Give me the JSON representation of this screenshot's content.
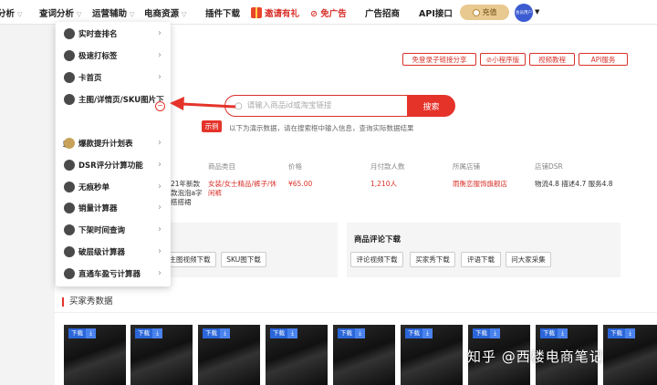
{
  "nav": {
    "items": [
      "分析",
      "查词分析",
      "运营辅助",
      "电商资源",
      "插件下载",
      "邀请有礼",
      "免广告",
      "广告招商",
      "API接口"
    ],
    "recharge": "充值",
    "avatar_text": "会员用户"
  },
  "menu": {
    "items": [
      {
        "label": "实时查排名",
        "icon": "medal-icon"
      },
      {
        "label": "极速打标签",
        "icon": "tag-icon"
      },
      {
        "label": "卡首页",
        "icon": "home-icon"
      },
      {
        "label": "主图/详情页/SKU图片下",
        "icon": "home-icon"
      },
      {
        "label": "爆款提升计划表",
        "icon": "bulb-icon"
      },
      {
        "label": "DSR评分计算功能",
        "icon": "dsr-icon"
      },
      {
        "label": "无痕秒单",
        "icon": "notepad-icon"
      },
      {
        "label": "销量计算器",
        "icon": "calculator-icon"
      },
      {
        "label": "下架时间查询",
        "icon": "sort-icon"
      },
      {
        "label": "破层级计算器",
        "icon": "layers-icon"
      },
      {
        "label": "直通车盈亏计算器",
        "icon": "calculator-icon"
      }
    ],
    "continuation": "载"
  },
  "toplinks": [
    "免登录子链接分享",
    "小程序版",
    "视频教程",
    "API服务"
  ],
  "search": {
    "placeholder": "请输入商品id或淘宝链接",
    "button": "搜索"
  },
  "example": {
    "badge": "示例",
    "note": "以下为演示数据，请在搜索框中输入信息，查询实际数据结果"
  },
  "product_table": {
    "columns": [
      "商品类目",
      "价格",
      "月付款人数",
      "所属店铺",
      "店铺DSR"
    ],
    "row": {
      "title": [
        "21年新款",
        "款泡泡a字",
        "搭搭裙"
      ],
      "category": [
        "女装/女士精品/裤子/休",
        "闲裤"
      ],
      "price": "¥65.00",
      "monthly_buyers": "1,210人",
      "shop": "雨衡恋服饰旗舰店",
      "dsr": "物流4.8 描述4.7 服务4.8"
    }
  },
  "downloads": {
    "left_buttons": [
      "主图视频下载",
      "SKU图下载"
    ],
    "review_title": "商品评论下载",
    "review_buttons": [
      "评论视频下载",
      "买家秀下载",
      "评语下载",
      "问大家采集"
    ]
  },
  "buyer_show": {
    "title": "买家秀数据",
    "download_label": "下载",
    "download_icon": "download-arrow-icon",
    "thumb_count": 9
  },
  "watermark": "知乎 @西楼电商笔记",
  "colors": {
    "brand_red": "#e5332a",
    "accent_gold": "#e8c98f",
    "download_blue": "#2b66d9"
  }
}
